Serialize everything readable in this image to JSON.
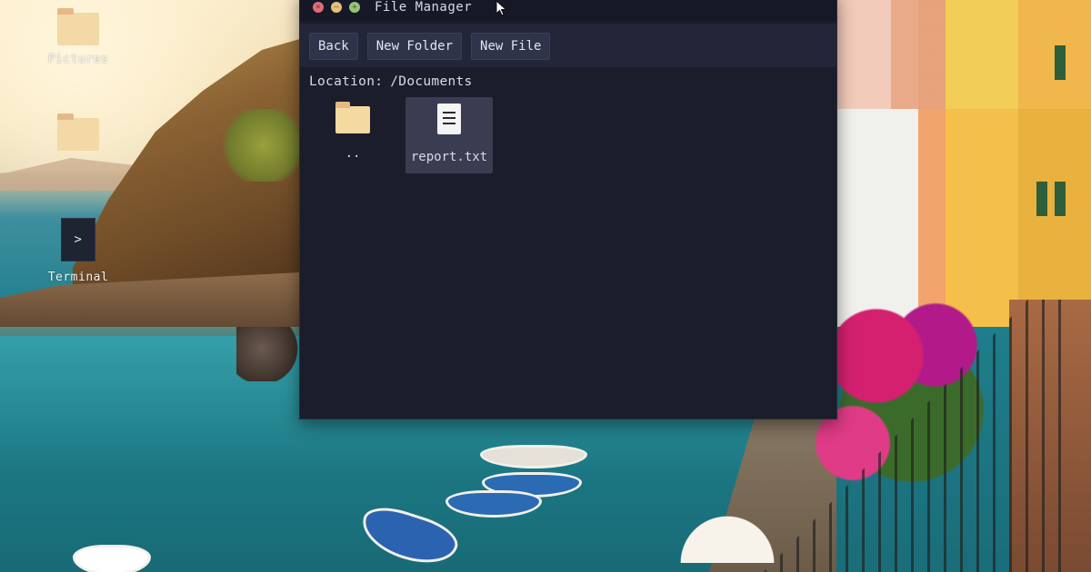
{
  "desktop": {
    "icons": [
      {
        "label": "Pictures",
        "icon": "folder-icon"
      },
      {
        "label": "",
        "icon": "folder-icon"
      },
      {
        "label": "Terminal",
        "icon": "terminal-icon",
        "glyph": ">"
      }
    ]
  },
  "window": {
    "title": "File Manager",
    "controls": [
      "close",
      "minimize",
      "maximize"
    ],
    "toolbar": {
      "back_label": "Back",
      "new_folder_label": "New Folder",
      "new_file_label": "New File"
    },
    "location_label": "Location:",
    "location_path": "/Documents",
    "files": [
      {
        "name": "..",
        "icon": "folder-icon",
        "selected": false
      },
      {
        "name": "report.txt",
        "icon": "text-file-icon",
        "selected": true
      }
    ]
  },
  "colors": {
    "window_bg": "#1b1d2b",
    "toolbar_bg": "#232638",
    "button_bg": "#30344a",
    "selection_bg": "#3a3d52",
    "folder_color": "#f4d9a0",
    "close_color": "#e06c75",
    "minimize_color": "#e5c07b",
    "maximize_color": "#98c379"
  }
}
